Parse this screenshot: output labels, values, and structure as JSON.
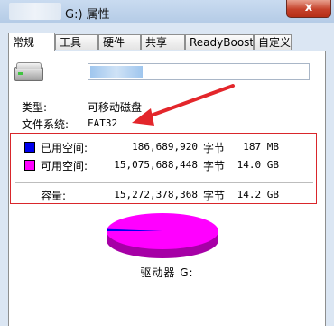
{
  "window": {
    "title": "G:) 属性",
    "close_label": "x"
  },
  "tabs": [
    {
      "label": "常规",
      "active": true
    },
    {
      "label": "工具"
    },
    {
      "label": "硬件"
    },
    {
      "label": "共享"
    },
    {
      "label": "ReadyBoost"
    },
    {
      "label": "自定义"
    }
  ],
  "general": {
    "drive_name_value": "",
    "type_label": "类型:",
    "type_value": "可移动磁盘",
    "fs_label": "文件系统:",
    "fs_value": "FAT32"
  },
  "space": {
    "used": {
      "label": "已用空间:",
      "bytes": "186,689,920",
      "unit": "字节",
      "size": "187 MB",
      "color": "#0000ee"
    },
    "free": {
      "label": "可用空间:",
      "bytes": "15,075,688,448",
      "unit": "字节",
      "size": "14.0 GB",
      "color": "#ff00ff"
    },
    "capacity": {
      "label": "容量:",
      "bytes": "15,272,378,368",
      "unit": "字节",
      "size": "14.2 GB"
    }
  },
  "pie": {
    "used_fraction": 0.012,
    "used_color": "#0000ee",
    "free_color": "#ff00ff"
  },
  "drive_label": "驱动器 G:",
  "annotation": {
    "arrow_color": "#e3262b"
  }
}
